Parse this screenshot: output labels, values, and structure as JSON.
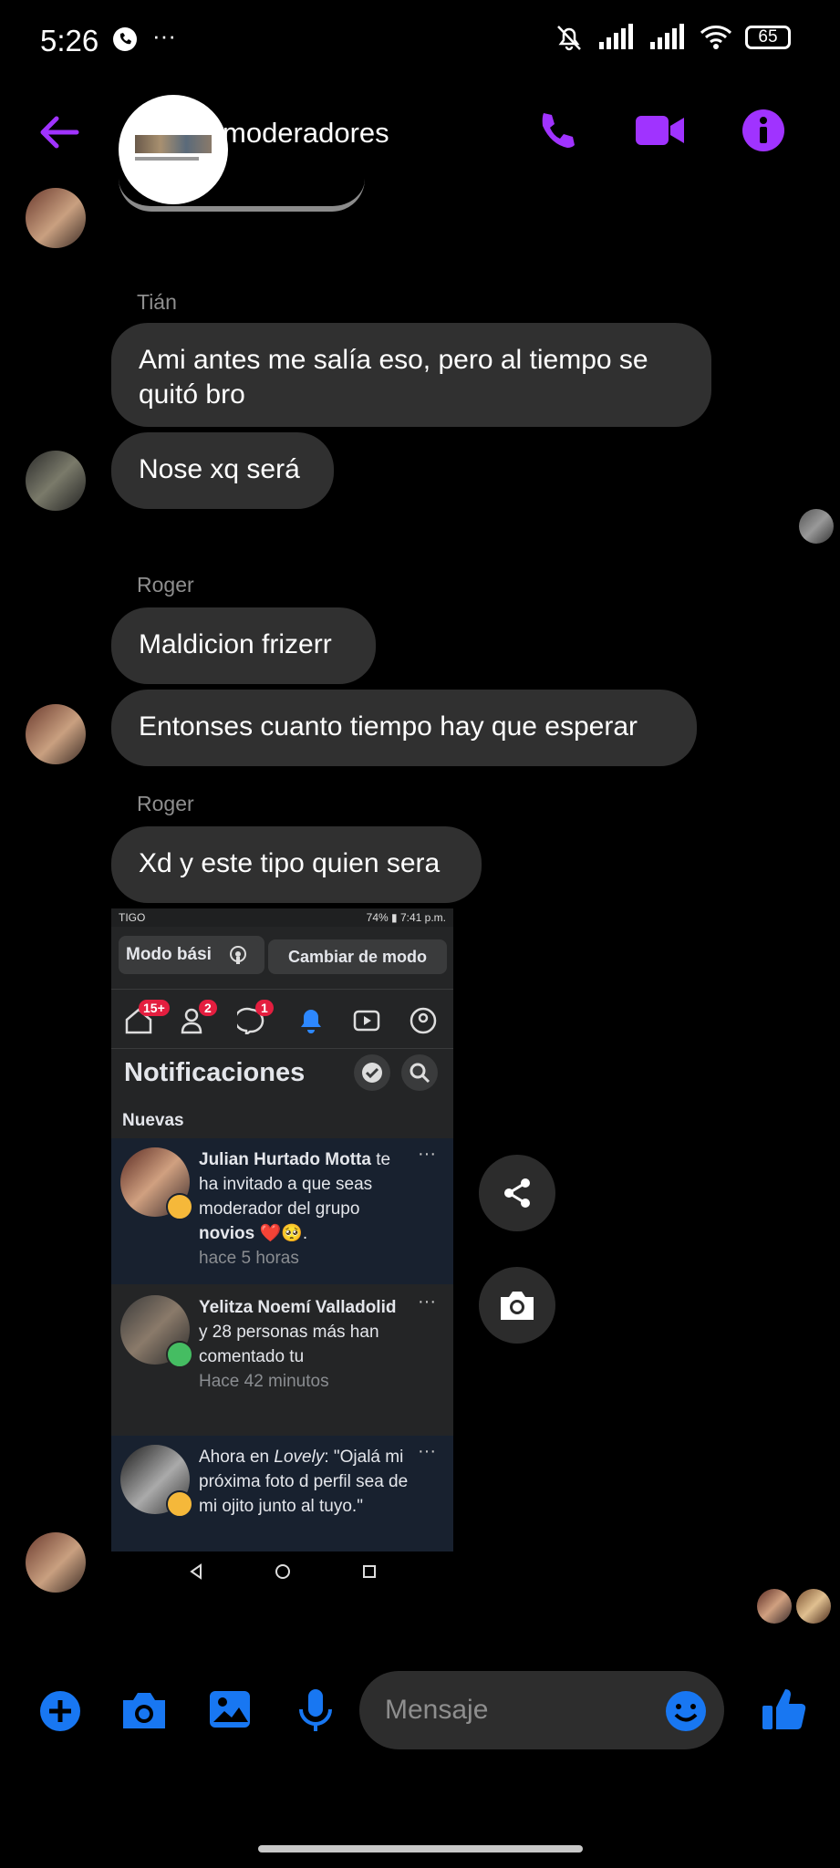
{
  "status_bar": {
    "time": "5:26",
    "more": "···",
    "battery": "65"
  },
  "header": {
    "title": "moderadores"
  },
  "messages": [
    {
      "sender": "Tián",
      "texts": [
        "Ami antes me salía eso, pero al tiempo se quitó bro",
        "Nose xq será"
      ]
    },
    {
      "sender": "Roger",
      "texts": [
        "Maldicion frizerr",
        "Entonses cuanto tiempo hay que esperar"
      ]
    },
    {
      "sender": "Roger",
      "texts": [
        "Xd y este tipo quien sera"
      ]
    }
  ],
  "shared_screenshot": {
    "status_left": "TIGO",
    "status_right": "74% ▮ 7:41 p.m.",
    "mode_label": "Modo bási",
    "switch_mode": "Cambiar de modo",
    "badges": {
      "home": "15+",
      "friends": "2",
      "messenger": "1"
    },
    "title": "Notificaciones",
    "section": "Nuevas",
    "notifications": [
      {
        "name": "Julian Hurtado Motta",
        "text": "te ha invitado a que seas moderador del grupo",
        "bold": "novios",
        "emoji": "❤️🥺.",
        "time": "hace 5 horas"
      },
      {
        "name": "Yelitza Noemí Valladolid",
        "text": "y 28 personas más han comentado tu",
        "time": "Hace 42 minutos"
      },
      {
        "prefix": "Ahora en",
        "italic": "Lovely",
        "text": ": \"Ojalá mi próxima foto d perfil sea de mi ojito junto al tuyo.\""
      }
    ],
    "more": "···"
  },
  "composer": {
    "placeholder": "Mensaje"
  },
  "colors": {
    "header_accent": "#a033ff",
    "composer_accent": "#1877f2",
    "bubble": "#303030"
  }
}
